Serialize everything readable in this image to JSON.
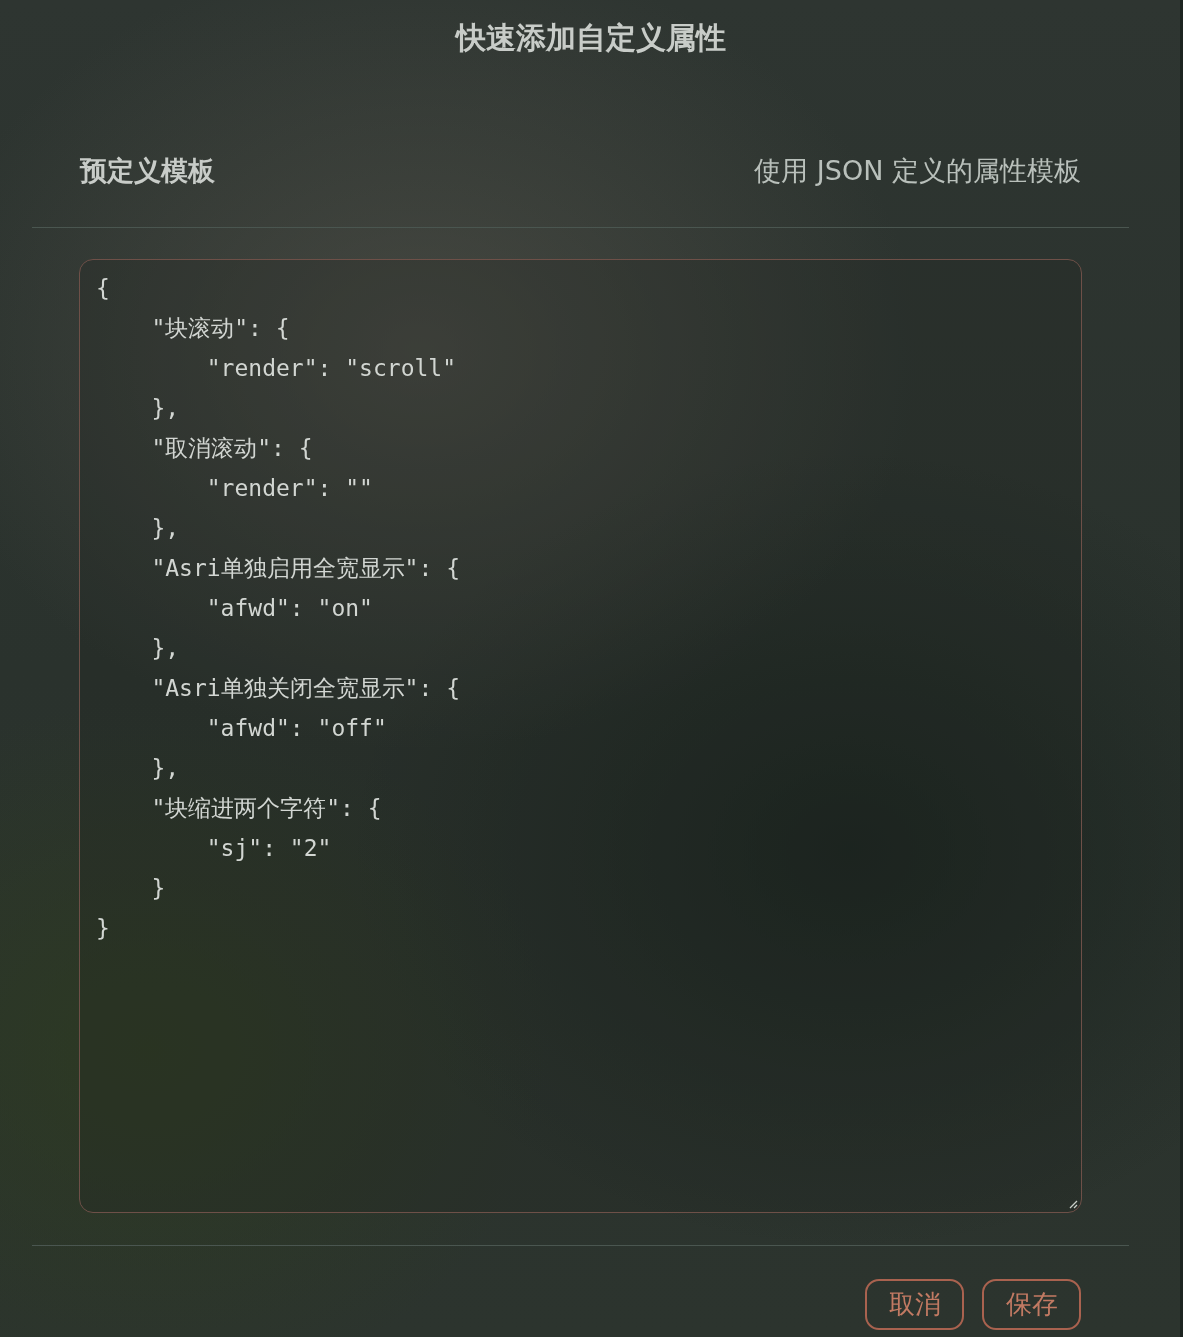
{
  "dialog": {
    "title": "快速添加自定义属性"
  },
  "section": {
    "label": "预定义模板",
    "description": "使用 JSON 定义的属性模板"
  },
  "editor": {
    "value": "{\n    \"块滚动\": {\n        \"render\": \"scroll\"\n    },\n    \"取消滚动\": {\n        \"render\": \"\"\n    },\n    \"Asri单独启用全宽显示\": {\n        \"afwd\": \"on\"\n    },\n    \"Asri单独关闭全宽显示\": {\n        \"afwd\": \"off\"\n    },\n    \"块缩进两个字符\": {\n        \"sj\": \"2\"\n    }\n}"
  },
  "buttons": [
    {
      "label": "取消"
    },
    {
      "label": "保存"
    }
  ]
}
